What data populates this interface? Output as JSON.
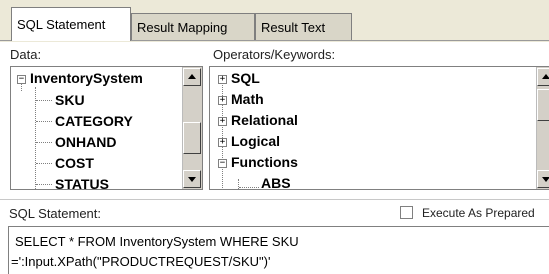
{
  "tabs": [
    {
      "label": "SQL Statement",
      "active": true
    },
    {
      "label": "Result Mapping",
      "active": false
    },
    {
      "label": "Result Text",
      "active": false
    }
  ],
  "data_panel": {
    "label": "Data:",
    "root": "InventorySystem",
    "fields": [
      "SKU",
      "CATEGORY",
      "ONHAND",
      "COST",
      "STATUS"
    ]
  },
  "operators_panel": {
    "label": "Operators/Keywords:",
    "items": [
      "SQL",
      "Math",
      "Relational",
      "Logical",
      "Functions"
    ],
    "sub_items": [
      "ABS"
    ]
  },
  "sql_section": {
    "label": "SQL Statement:",
    "execute_as_prepared_label": "Execute As Prepared",
    "execute_as_prepared_checked": false,
    "lines": [
      "SELECT * FROM InventorySystem WHERE SKU",
      "=':Input.XPath(\"PRODUCTREQUEST/SKU\")'"
    ]
  }
}
